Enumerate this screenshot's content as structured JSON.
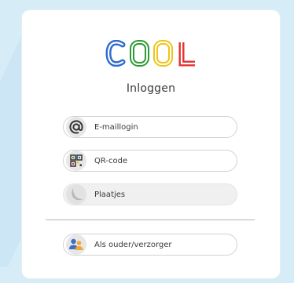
{
  "logo": {
    "letters": [
      "C",
      "O",
      "O",
      "L"
    ],
    "colors": [
      "#2f6bcf",
      "#2e9a35",
      "#f0c419",
      "#e2332f"
    ]
  },
  "title": "Inloggen",
  "buttons": [
    {
      "label": "E-maillogin",
      "icon": "at-icon"
    },
    {
      "label": "QR-code",
      "icon": "qr-code-icon"
    },
    {
      "label": "Plaatjes",
      "icon": "moon-icon"
    }
  ],
  "parent_button": {
    "label": "Als ouder/verzorger",
    "icon": "parents-icon"
  }
}
